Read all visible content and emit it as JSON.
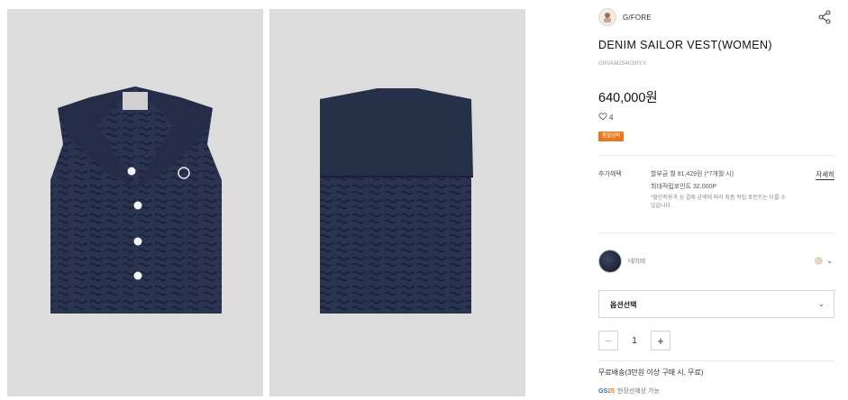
{
  "gallery": {
    "images": [
      {
        "alt": "front"
      },
      {
        "alt": "back"
      }
    ]
  },
  "product": {
    "brand": "G/FORE",
    "title": "DENIM SAILOR VEST(WOMEN)",
    "code": "GNVAM25403NYX",
    "price": "640,000원",
    "likes": "4",
    "badge": "품절임박"
  },
  "benefits": {
    "label": "추가혜택",
    "installment": "할부금 월 91,429원 (*7개월 시)",
    "points": "최대적립포인트 32,000P",
    "note": "*할인적용과 상 결제 금액에 따라 최종 적립 포인트는 다를 수 있습니다.",
    "detail_link": "자세히"
  },
  "color": {
    "label": "네이비",
    "swatch_color": "#27304a",
    "alt_dot_color": "#e4d5bc"
  },
  "option": {
    "select_label": "옵션선택"
  },
  "quantity": {
    "value": "1",
    "minus": "−",
    "plus": "+"
  },
  "shipping": {
    "text": "무료배송(3만원 이상 구매 시, 무료)",
    "pickup": "현장선예상 가능",
    "logo_g": "GS",
    "logo_n": "25"
  },
  "colors": {
    "badge": "#e67a1e",
    "photo_bg": "#dcdcdc",
    "vest": "#2a3350"
  }
}
